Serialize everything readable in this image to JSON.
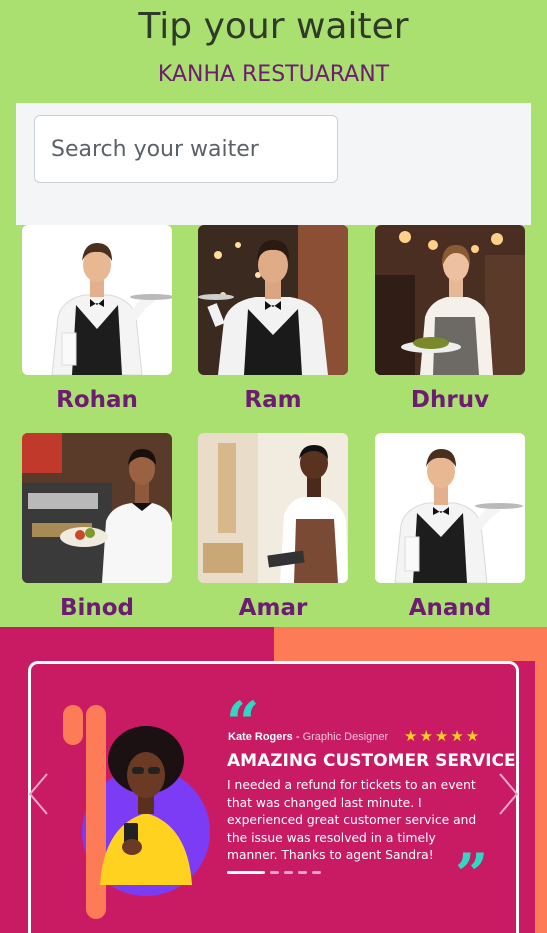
{
  "header": {
    "title": "Tip your waiter",
    "restaurant": "KANHA RESTUARANT"
  },
  "search": {
    "placeholder": "Search your waiter",
    "value": ""
  },
  "waiters": [
    {
      "name": "Rohan"
    },
    {
      "name": "Ram"
    },
    {
      "name": "Dhruv"
    },
    {
      "name": "Binod"
    },
    {
      "name": "Amar"
    },
    {
      "name": "Anand"
    }
  ],
  "testimonial": {
    "reviewer_name": "Kate Rogers",
    "separator": " - ",
    "reviewer_role": "Graphic Designer",
    "stars": "★★★★★",
    "rating": 5,
    "headline": "AMAZING CUSTOMER SERVICE",
    "text": "I needed a refund for tickets to an event that was changed last minute. I experienced great customer service and the issue was resolved in a timely manner. Thanks to agent Sandra!",
    "open_quote": "“",
    "close_quote": "”",
    "slide_count": 5,
    "active_slide": 1
  },
  "colors": {
    "page_bg": "#a9e070",
    "accent_purple": "#6e1b73",
    "testimonial_bg": "#c91b64",
    "accent_orange": "#fd7b57",
    "quote_teal": "#2ed8c3",
    "star_yellow": "#ffd21f"
  },
  "icons": {
    "prev": "chevron-left-icon",
    "next": "chevron-right-icon",
    "star": "star-icon",
    "quote": "quote-icon"
  }
}
